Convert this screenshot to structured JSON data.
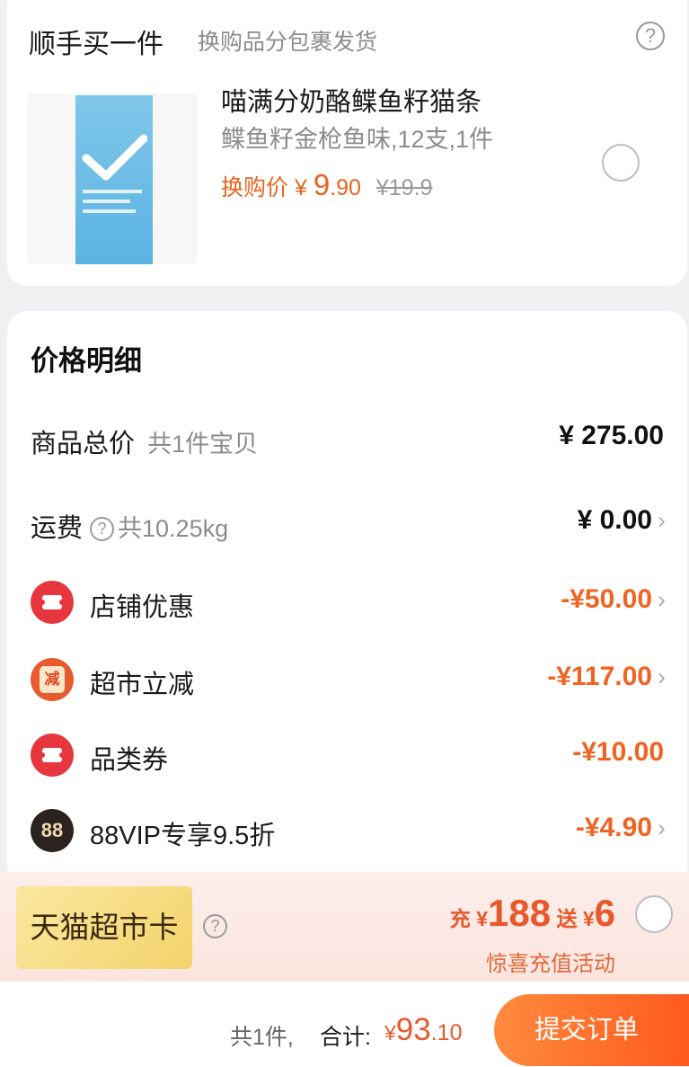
{
  "upsell": {
    "title": "顺手买一件",
    "subtitle": "换购品分包裹发货",
    "product": {
      "name": "喵满分奶酪鲽鱼籽猫条",
      "spec": "鲽鱼籽金枪鱼味,12支,1件",
      "price_label": "换购价",
      "price_yen": "¥",
      "price_int": "9",
      "price_dec": ".90",
      "original_price": "¥19.9"
    }
  },
  "price_detail": {
    "title": "价格明细",
    "rows": [
      {
        "label": "商品总价",
        "sub": "共1件宝贝",
        "amount": "¥ 275.00"
      },
      {
        "label": "运费",
        "sub": "共10.25kg",
        "amount": "¥ 0.00"
      },
      {
        "label": "店铺优惠",
        "amount": "-¥50.00"
      },
      {
        "label": "超市立减",
        "icon_text": "减",
        "amount": "-¥117.00"
      },
      {
        "label": "品类券",
        "amount": "-¥10.00"
      },
      {
        "label": "88VIP专享9.5折",
        "icon_text": "88",
        "amount": "-¥4.90"
      }
    ]
  },
  "tmall_card": {
    "label": "天猫超市卡",
    "recharge_prefix": "充",
    "recharge_yen": "¥",
    "recharge_amount": "188",
    "gift_label": "送",
    "gift_yen": "¥",
    "gift_amount": "6",
    "activity": "惊喜充值活动"
  },
  "footer": {
    "count": "共1件,",
    "total_label": "合计:",
    "total_yen": "¥",
    "total_int": "93",
    "total_dec": ".10",
    "submit_label": "提交订单"
  },
  "chevron": "›",
  "help_glyph": "?",
  "colors": {
    "accent_orange": "#f06423",
    "coupon_red": "#e8363f",
    "vip_dark": "#2a2320",
    "card_gold": "#f3d36a"
  }
}
